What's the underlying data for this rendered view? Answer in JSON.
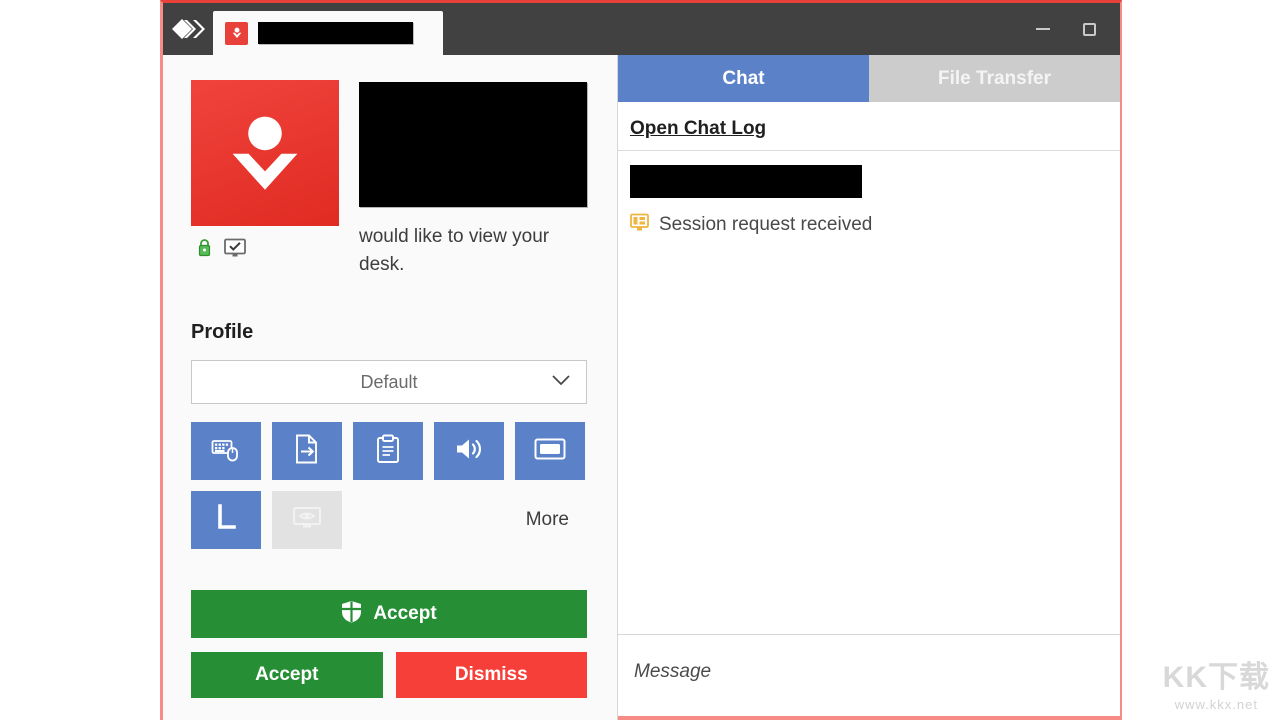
{
  "window": {
    "accent_red": "#e8413a",
    "titlebar_bg": "#414141",
    "logo_icon": "anydesk-logo-icon",
    "tab": {
      "favicon_icon": "anydesk-person-down-icon",
      "title_redacted": true
    },
    "controls": {
      "minimize_label": "Minimize",
      "maximize_label": "Maximize"
    }
  },
  "request": {
    "avatar_icon": "person-download-avatar-icon",
    "peer_name_redacted": true,
    "message": "would like to view your desk.",
    "status_icons": [
      {
        "name": "secure-lock-icon",
        "color": "#3aa13a"
      },
      {
        "name": "verified-monitor-icon",
        "color": "#6b6b6b"
      }
    ]
  },
  "profile": {
    "label": "Profile",
    "selected": "Default",
    "chevron_icon": "chevron-down-icon",
    "options": [
      "Default"
    ]
  },
  "permissions": {
    "buttons": [
      {
        "name": "permission-input-control",
        "icon": "keyboard-mouse-icon",
        "enabled": true
      },
      {
        "name": "permission-file-transfer",
        "icon": "file-arrow-icon",
        "enabled": true
      },
      {
        "name": "permission-clipboard",
        "icon": "clipboard-icon",
        "enabled": true
      },
      {
        "name": "permission-audio",
        "icon": "speaker-icon",
        "enabled": true
      },
      {
        "name": "permission-screenshot",
        "icon": "screen-capture-icon",
        "enabled": true
      },
      {
        "name": "permission-whiteboard",
        "icon": "draw-whiteboard-icon",
        "enabled": true
      },
      {
        "name": "permission-privacy-mode",
        "icon": "privacy-monitor-icon",
        "enabled": false
      }
    ],
    "more_label": "More",
    "enabled_color": "#5b82c8",
    "disabled_color": "#e2e2e2"
  },
  "actions": {
    "accept_primary": "Accept",
    "accept_primary_icon": "shield-icon",
    "accept_secondary": "Accept",
    "dismiss": "Dismiss",
    "accept_color": "#268f36",
    "dismiss_color": "#f73f3a"
  },
  "side_panel": {
    "tabs": [
      {
        "label": "Chat",
        "active": true
      },
      {
        "label": "File Transfer",
        "active": false
      }
    ],
    "open_chat_log": "Open Chat Log",
    "messages": [
      {
        "sender_redacted": true,
        "icon": "session-request-monitor-icon",
        "text": "Session request received"
      }
    ],
    "input_placeholder": "Message"
  },
  "watermark": {
    "logo_text": "KK下载",
    "url": "www.kkx.net"
  }
}
